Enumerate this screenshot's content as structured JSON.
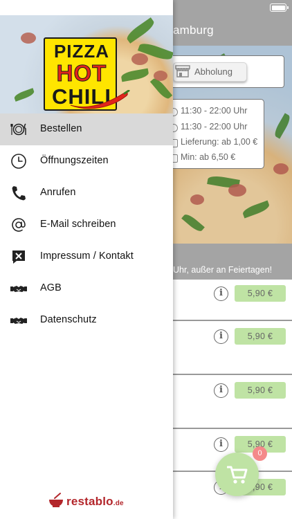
{
  "app": {
    "title_partial": "lamburg",
    "delivery_mode": {
      "label": "Abholung",
      "icon": "store-icon"
    },
    "info_lines": [
      {
        "text": "11:30 - 22:00 Uhr",
        "icon": "clock-icon"
      },
      {
        "text": "11:30 - 22:00 Uhr",
        "icon": "clock-icon"
      },
      {
        "text": "Lieferung: ab 1,00 €",
        "icon": "delivery-icon"
      },
      {
        "text": "Min: ab 6,50 €",
        "icon": "basket-icon"
      }
    ],
    "notice": "Uhr, außer an Feiertagen!",
    "products": [
      {
        "price": "5,90 €"
      },
      {
        "price": "5,90 €"
      },
      {
        "price": "5,90 €"
      },
      {
        "price": "5,90 €"
      },
      {
        "price": "5,90 €"
      }
    ],
    "info_glyph": "i",
    "cart": {
      "count": "0"
    },
    "accent_color": "#bfe3a4"
  },
  "drawer": {
    "logo": {
      "line1": "PIZZA",
      "line2": "HOT",
      "line3": "CHILI"
    },
    "items": [
      {
        "label": "Bestellen",
        "icon": "plate-cutlery-icon",
        "active": true
      },
      {
        "label": "Öffnungszeiten",
        "icon": "clock-icon"
      },
      {
        "label": "Anrufen",
        "icon": "phone-icon"
      },
      {
        "label": "E-Mail schreiben",
        "icon": "at-sign-icon"
      },
      {
        "label": "Impressum / Kontakt",
        "icon": "contact-card-icon"
      },
      {
        "label": "AGB",
        "icon": "handshake-icon"
      },
      {
        "label": "Datenschutz",
        "icon": "handshake-icon"
      }
    ],
    "brand": {
      "name": "restablo",
      "tld": ".de"
    }
  }
}
